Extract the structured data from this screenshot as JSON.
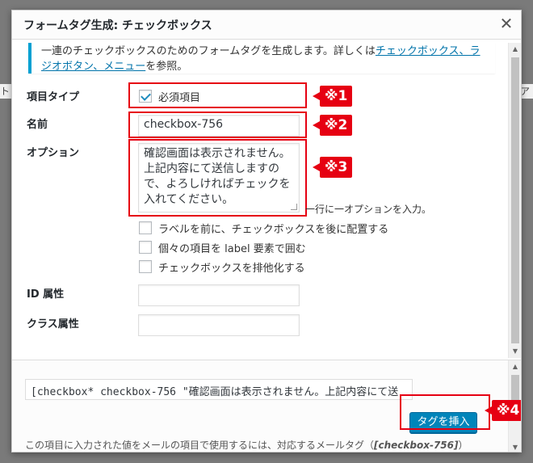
{
  "background": {
    "left_fragment": "ト",
    "right_fragment": "ア"
  },
  "dialog": {
    "title": "フォームタグ生成: チェックボックス",
    "close_icon": "close-icon"
  },
  "notice": {
    "text_before": "一連のチェックボックスのためのフォームタグを生成します。詳しくは",
    "link": "チェックボックス、ラジオボタン、メニュー",
    "text_after": "を参照。"
  },
  "fields": {
    "item_type_label": "項目タイプ",
    "required_label": "必須項目",
    "required_checked": true,
    "name_label": "名前",
    "name_value": "checkbox-756",
    "options_label": "オプション",
    "options_value": "確認画面は表示されません。上記内容にて送信しますので、よろしければチェックを入れてください。",
    "options_hint": "一行に一オプションを入力。",
    "label_first": "ラベルを前に、チェックボックスを後に配置する",
    "use_label_element": "個々の項目を label 要素で囲む",
    "exclusive": "チェックボックスを排他化する",
    "id_label": "ID 属性",
    "id_value": "",
    "class_label": "クラス属性",
    "class_value": ""
  },
  "markers": {
    "m1": "※1",
    "m2": "※2",
    "m3": "※3",
    "m4": "※4"
  },
  "footer": {
    "tag_value": "[checkbox* checkbox-756 \"確認画面は表示されません。上記内容にて送",
    "insert_button": "タグを挿入",
    "mail_note": "この項目に入力された値をメールの項目で使用するには、対応するメールタグ（",
    "mail_tag": "[checkbox-756]",
    "mail_note_end": "）"
  },
  "colors": {
    "accent": "#0085ba",
    "marker": "#e60012",
    "notice_border": "#00a0d2"
  }
}
